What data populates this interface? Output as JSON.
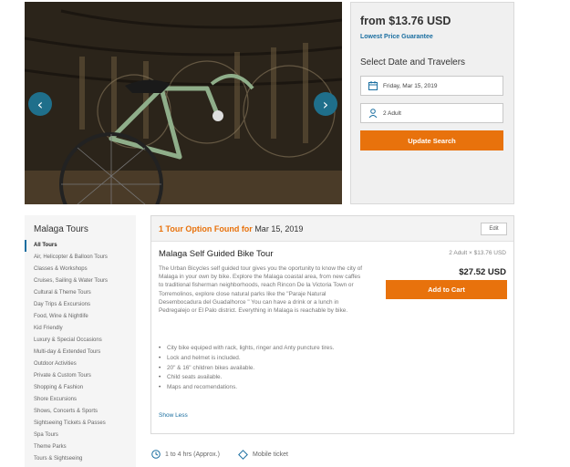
{
  "gallery": {
    "prev_icon": "chevron-left-icon",
    "next_icon": "chevron-right-icon",
    "prev_glyph": "‹",
    "next_glyph": "›"
  },
  "booking": {
    "price_from": "from $13.76 USD",
    "lowest_price": "Lowest Price Guarantee",
    "select_title": "Select Date and Travelers",
    "date_value": "Friday, Mar 15, 2019",
    "travelers_value": "2 Adult",
    "update_label": "Update Search"
  },
  "sidebar": {
    "title": "Malaga Tours",
    "items": [
      {
        "label": "All Tours",
        "active": true
      },
      {
        "label": "Air, Helicopter & Balloon Tours"
      },
      {
        "label": "Classes & Workshops"
      },
      {
        "label": "Cruises, Sailing & Water Tours"
      },
      {
        "label": "Cultural & Theme Tours"
      },
      {
        "label": "Day Trips & Excursions"
      },
      {
        "label": "Food, Wine & Nightlife"
      },
      {
        "label": "Kid Friendly"
      },
      {
        "label": "Luxury & Special Occasions"
      },
      {
        "label": "Multi-day & Extended Tours"
      },
      {
        "label": "Outdoor Activities"
      },
      {
        "label": "Private & Custom Tours"
      },
      {
        "label": "Shopping & Fashion"
      },
      {
        "label": "Shore Excursions"
      },
      {
        "label": "Shows, Concerts & Sports"
      },
      {
        "label": "Sightseeing Tickets & Passes"
      },
      {
        "label": "Spa Tours"
      },
      {
        "label": "Theme Parks"
      },
      {
        "label": "Tours & Sightseeing"
      }
    ]
  },
  "results": {
    "found_count": "1 Tour Option Found for",
    "found_date": " Mar 15, 2019",
    "edit_label": "Edit",
    "option": {
      "title": "Malaga Self Guided Bike Tour",
      "description": "The Urban Bicycles self guided tour gives you the oportunity to know the city of Malaga in your own by bike. Explore the Malaga coastal area, from new caffes to traditional fisherman neighborhoods, reach Rincon De la Victoria Town or Torremolinos, explore close natural parks like the \"Paraje Natural Desembocadura del Guadalhorce \" You can have a drink or a lunch in Pedregalejo or El Palo district. Everything  in Malaga is reachable by bike.",
      "bullets": [
        "City bike equiped with rack, lights, ringer and Anty puncture tires.",
        "Lock and helmet is included.",
        "20\" & 16\" children bikes available.",
        "Child seats available.",
        "Maps and recomendations."
      ],
      "show_less": "Show Less",
      "price_calc": "2 Adult × $13.76 USD",
      "price_total": "$27.52 USD",
      "add_to_cart": "Add to Cart"
    }
  },
  "meta": {
    "duration": "1 to 4 hrs (Approx.)",
    "ticket": "Mobile ticket"
  },
  "colors": {
    "accent_orange": "#e8720c",
    "link_blue": "#1a6ea0",
    "nav_teal": "#1f6f8b",
    "bike_green": "#8fae8a"
  }
}
